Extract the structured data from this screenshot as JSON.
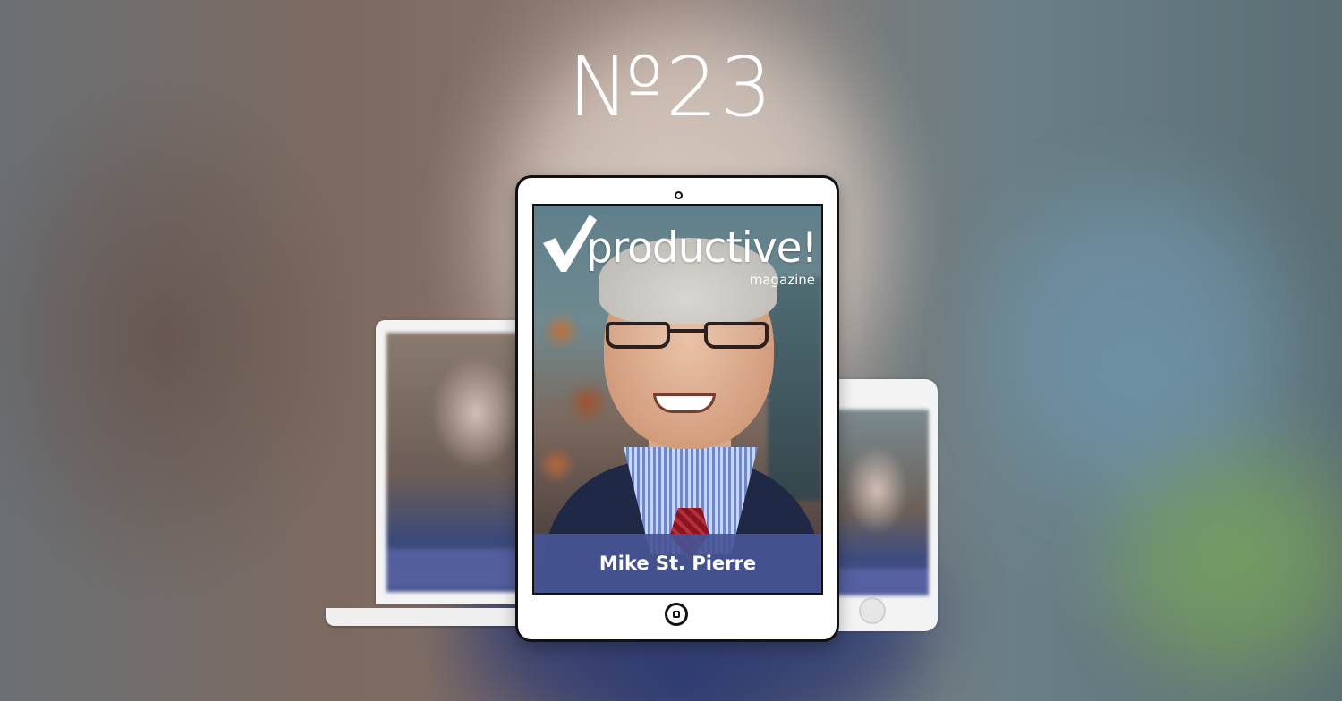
{
  "issue": {
    "number_label": "№23"
  },
  "cover": {
    "logo_word": "productive!",
    "logo_sub": "magazine",
    "person_name": "Mike St. Pierre"
  },
  "devices": [
    "laptop",
    "tablet",
    "phone"
  ],
  "colors": {
    "name_band": "#4655a0",
    "device_frame": "#111111",
    "logo_text": "#ffffff"
  }
}
